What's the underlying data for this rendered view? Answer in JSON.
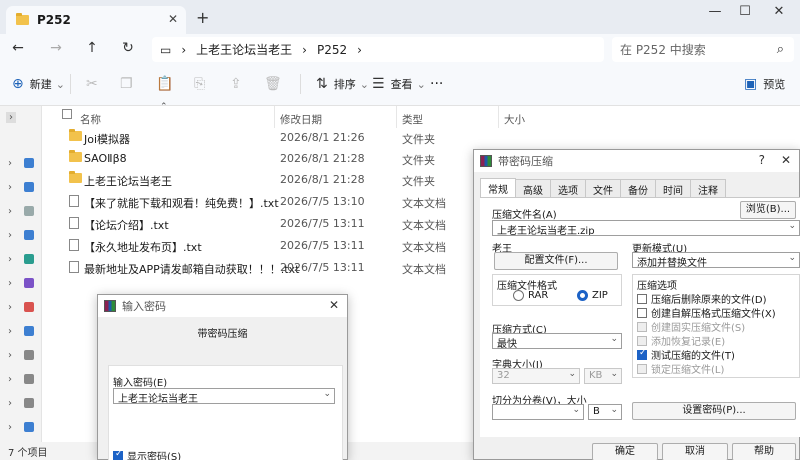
{
  "explorer": {
    "tab_title": "P252",
    "breadcrumb": [
      "上老王论坛当老王",
      "P252"
    ],
    "search_placeholder": "在 P252 中搜索",
    "toolbar": {
      "new": "新建",
      "sort": "排序",
      "view": "查看",
      "preview": "预览"
    },
    "columns": {
      "name": "名称",
      "date": "修改日期",
      "type": "类型",
      "size": "大小"
    },
    "files": [
      {
        "name": "Joi模拟器",
        "date": "2026/8/1 21:26",
        "type": "文件夹",
        "icon": "folder"
      },
      {
        "name": "SAOⅡβ8",
        "date": "2026/8/1 21:28",
        "type": "文件夹",
        "icon": "folder"
      },
      {
        "name": "上老王论坛当老王",
        "date": "2026/8/1 21:28",
        "type": "文件夹",
        "icon": "folder"
      },
      {
        "name": "【来了就能下载和观看！纯免费！】.txt",
        "date": "2026/7/5 13:10",
        "type": "文本文档",
        "icon": "text-file"
      },
      {
        "name": "【论坛介绍】.txt",
        "date": "2026/7/5 13:11",
        "type": "文本文档",
        "icon": "text-file"
      },
      {
        "name": "【永久地址发布页】.txt",
        "date": "2026/7/5 13:11",
        "type": "文本文档",
        "icon": "text-file"
      },
      {
        "name": "最新地址及APP请发邮箱自动获取！！！.txt",
        "date": "2026/7/5 13:11",
        "type": "文本文档",
        "icon": "text-file"
      }
    ],
    "status": "7 个项目"
  },
  "pwd_dialog": {
    "title": "输入密码",
    "subtitle": "带密码压缩",
    "label": "输入密码(E)",
    "value": "上老王论坛当老王",
    "show_password": "显示密码(S)"
  },
  "archive_dialog": {
    "title": "带密码压缩",
    "tabs": [
      "常规",
      "高级",
      "选项",
      "文件",
      "备份",
      "时间",
      "注释"
    ],
    "archive_name_label": "压缩文件名(A)",
    "archive_name": "上老王论坛当老王.zip",
    "browse": "浏览(B)...",
    "profile_label": "老王",
    "profile_button": "配置文件(F)...",
    "update_label": "更新模式(U)",
    "update_value": "添加并替换文件",
    "format_label": "压缩文件格式",
    "format_rar": "RAR",
    "format_zip": "ZIP",
    "options_label": "压缩选项",
    "options": [
      {
        "label": "压缩后删除原来的文件(D)",
        "checked": false,
        "disabled": false
      },
      {
        "label": "创建自解压格式压缩文件(X)",
        "checked": false,
        "disabled": false
      },
      {
        "label": "创建固实压缩文件(S)",
        "checked": false,
        "disabled": true
      },
      {
        "label": "添加恢复记录(E)",
        "checked": false,
        "disabled": true
      },
      {
        "label": "测试压缩的文件(T)",
        "checked": true,
        "disabled": false
      },
      {
        "label": "锁定压缩文件(L)",
        "checked": false,
        "disabled": true
      }
    ],
    "method_label": "压缩方式(C)",
    "method_value": "最快",
    "dict_label": "字典大小(I)",
    "dict_value": "32",
    "dict_unit": "KB",
    "split_label": "切分为分卷(V)，大小",
    "split_unit": "B",
    "set_password": "设置密码(P)...",
    "ok": "确定",
    "cancel": "取消",
    "help": "帮助"
  }
}
